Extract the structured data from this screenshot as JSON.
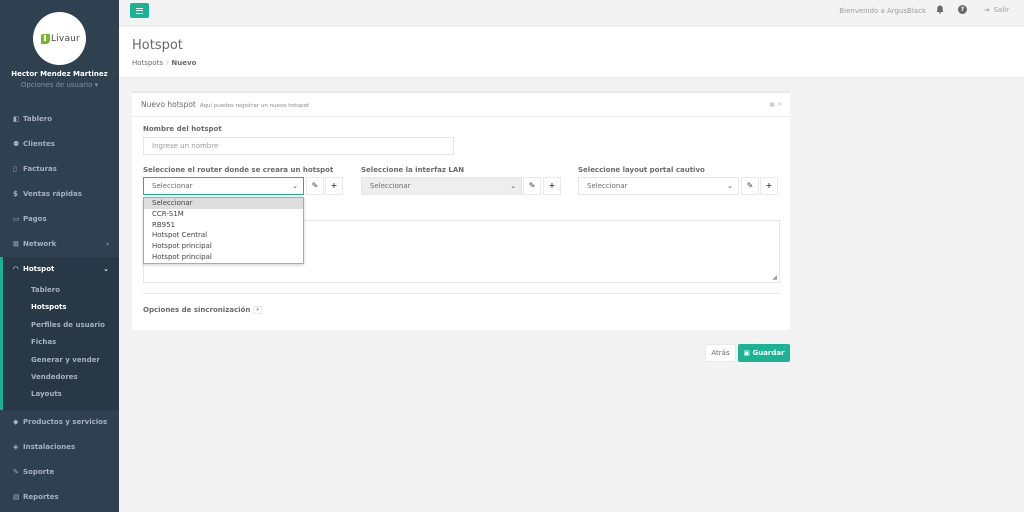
{
  "sidebar": {
    "logo_text": "Livaur",
    "user_name": "Hector Mendez Martinez",
    "user_options": "Opciones de usuario",
    "items": [
      {
        "label": "Tablero",
        "icon": "dashboard-icon"
      },
      {
        "label": "Clientes",
        "icon": "users-icon"
      },
      {
        "label": "Facturas",
        "icon": "file-icon"
      },
      {
        "label": "Ventas rápidas",
        "icon": "dollar-icon"
      },
      {
        "label": "Pagos",
        "icon": "money-icon"
      },
      {
        "label": "Network",
        "icon": "sitemap-icon"
      },
      {
        "label": "Hotspot",
        "icon": "wifi-icon"
      }
    ],
    "hotspot_sub": [
      {
        "label": "Tablero"
      },
      {
        "label": "Hotspots"
      },
      {
        "label": "Perfiles de usuario"
      },
      {
        "label": "Fichas"
      },
      {
        "label": "Generar y vender"
      },
      {
        "label": "Vendedores"
      },
      {
        "label": "Layouts"
      }
    ],
    "items_after": [
      {
        "label": "Productos y servicios",
        "icon": "tag-icon"
      },
      {
        "label": "Instalaciones",
        "icon": "diamond-icon"
      },
      {
        "label": "Soporte",
        "icon": "wrench-icon"
      },
      {
        "label": "Reportes",
        "icon": "book-icon"
      }
    ]
  },
  "topbar": {
    "welcome": "Bienvenido a ArgusBlack",
    "logout": "Salir"
  },
  "heading": {
    "title": "Hotspot",
    "breadcrumb_parent": "Hotspots",
    "breadcrumb_current": "Nuevo"
  },
  "panel": {
    "title": "Nuevo hotspot",
    "subtitle": "Aqui puedes registrar un nuevo hotspot",
    "name_label": "Nombre del hotspot",
    "name_placeholder": "Ingrese un nombre",
    "router_label": "Seleccione el router donde se creara un hotspot",
    "router_value": "Seleccionar",
    "lan_label": "Seleccione la interfaz LAN",
    "lan_value": "Seleccionar",
    "layout_label": "Seleccione layout portal cautivo",
    "layout_value": "Seleccionar",
    "sync_label": "Opciones de sincronización"
  },
  "router_options": [
    "Seleccionar",
    "CCR-S1M",
    "RB951",
    "Hotspot Central",
    "Hotspot principal",
    "Hotspot principal"
  ],
  "buttons": {
    "back": "Atrás",
    "save": "Guardar"
  },
  "colors": {
    "sidebar_bg": "#2f4050",
    "accent": "#1ab394",
    "logo_green": "#76b82a"
  }
}
